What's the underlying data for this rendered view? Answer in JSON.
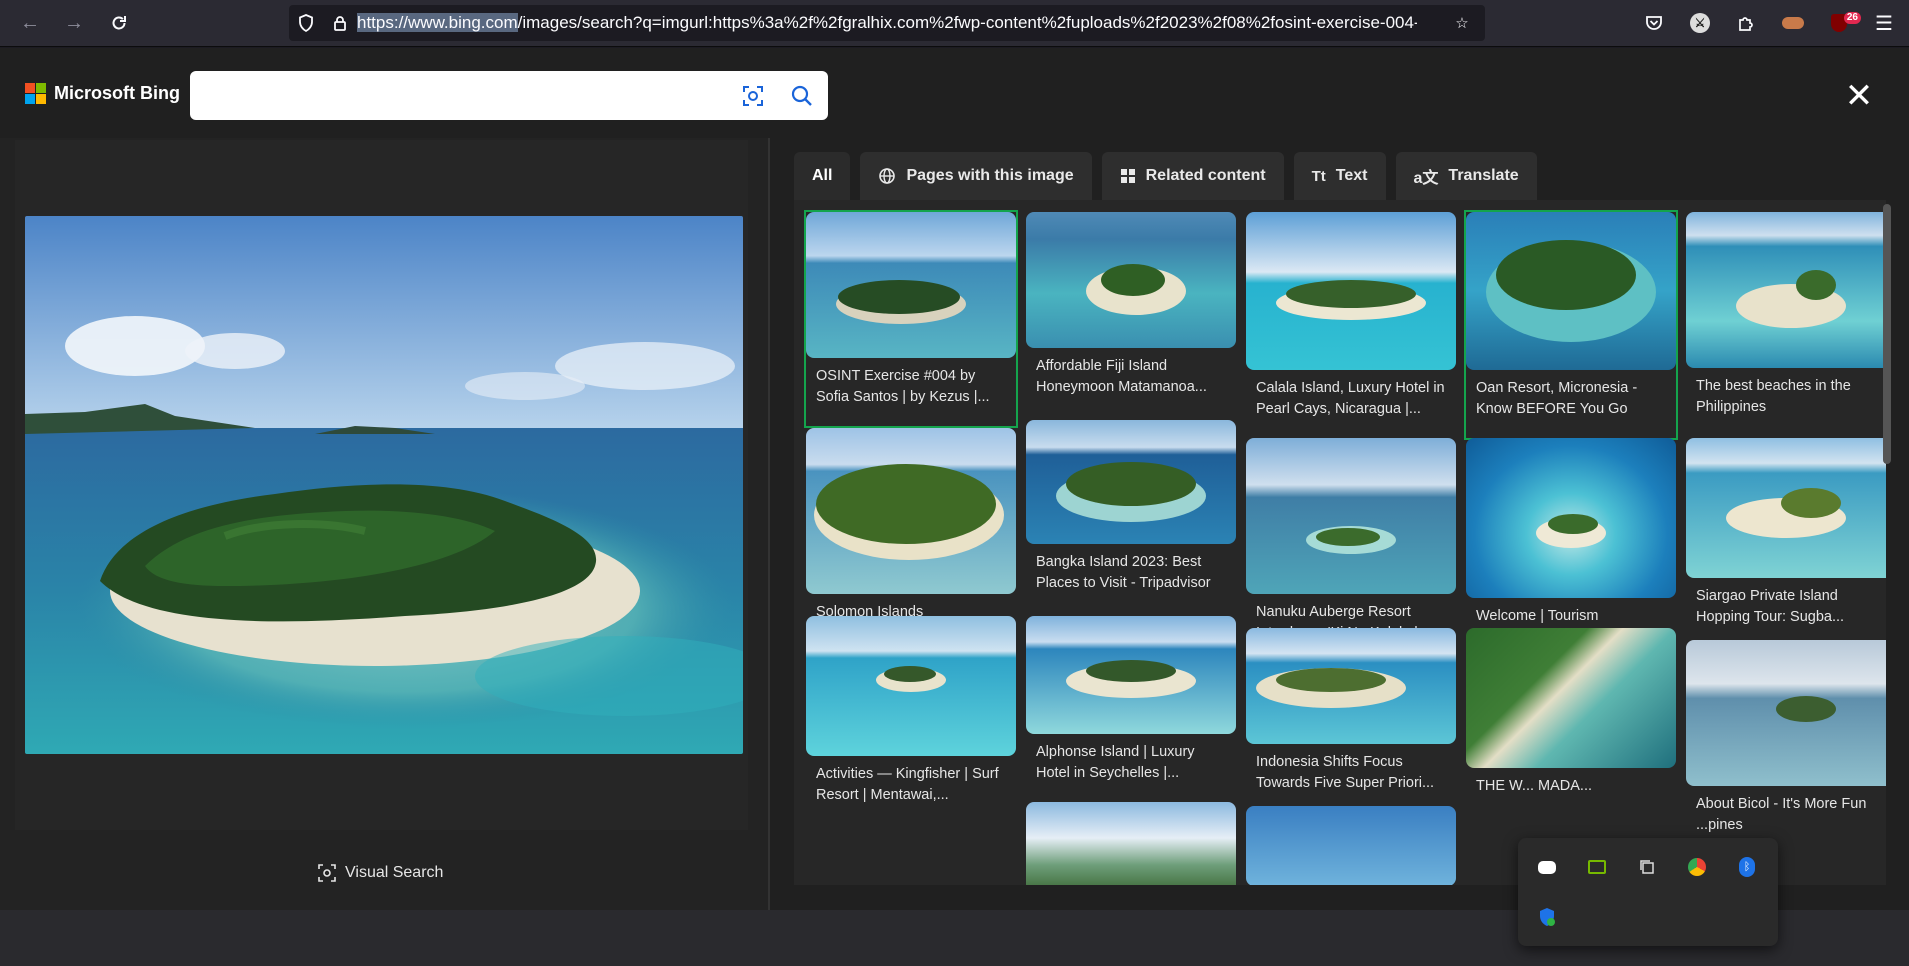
{
  "browser": {
    "url_host": "https://www.bing.com",
    "url_path": "/images/search?q=imgurl:https%3a%2f%2fgralhix.com%2fwp-content%2fuploads%2f2023%2f08%2fosint-exercise-004-",
    "extension_badge": "26"
  },
  "header": {
    "logo_text": "Microsoft Bing",
    "search_value": "",
    "search_placeholder": ""
  },
  "left": {
    "visual_search_label": "Visual Search"
  },
  "tabs": [
    {
      "label": "All",
      "icon": "none"
    },
    {
      "label": "Pages with this image",
      "icon": "globe-icon"
    },
    {
      "label": "Related content",
      "icon": "grid-icon"
    },
    {
      "label": "Text",
      "icon": "text-icon"
    },
    {
      "label": "Translate",
      "icon": "translate-icon"
    }
  ],
  "results": [
    {
      "caption": "OSINT Exercise #004 by Sofia Santos | by Kezus |...",
      "selected": true
    },
    {
      "caption": "Affordable Fiji Island Honeymoon Matamanoa...",
      "selected": false
    },
    {
      "caption": "Calala Island, Luxury Hotel in Pearl Cays, Nicaragua |...",
      "selected": false
    },
    {
      "caption": "Oan Resort, Micronesia - Know BEFORE You Go",
      "selected": true
    },
    {
      "caption": "The best beaches in the Philippines",
      "selected": false
    },
    {
      "caption": "Solomon Islands Government Portal -...",
      "selected": false
    },
    {
      "caption": "Bangka Island 2023: Best Places to Visit - Tripadvisor",
      "selected": false
    },
    {
      "caption": "Nanuku Auberge Resort Introduces 'Ki Na Kalokal...",
      "selected": false
    },
    {
      "caption": "Welcome | Tourism Solomons",
      "selected": false
    },
    {
      "caption": "Siargao Private Island Hopping Tour: Sugba...",
      "selected": false
    },
    {
      "caption": "Activities — Kingfisher | Surf Resort | Mentawai,...",
      "selected": false
    },
    {
      "caption": "Alphonse Island | Luxury Hotel in Seychelles |...",
      "selected": false
    },
    {
      "caption": "Indonesia Shifts Focus Towards Five Super Priori...",
      "selected": false
    },
    {
      "caption": "THE W... MADA...",
      "selected": false
    },
    {
      "caption": "About Bicol - It's More Fun ...pines",
      "selected": false
    }
  ],
  "tray_icons": [
    "discord-icon",
    "nvidia-icon",
    "copy-icon",
    "chrome-icon",
    "bluetooth-icon",
    "defender-icon"
  ]
}
